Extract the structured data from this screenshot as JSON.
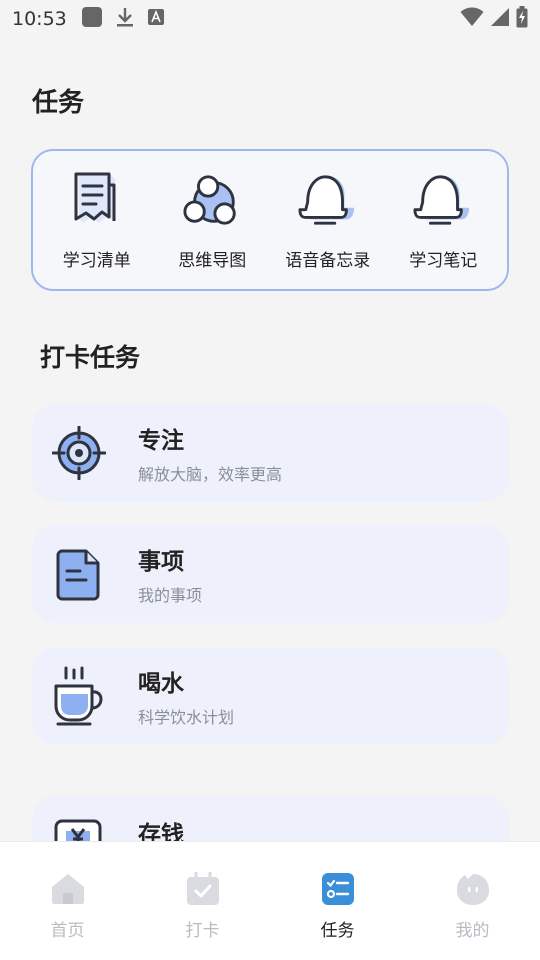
{
  "status_bar": {
    "time": "10:53",
    "left_icons": [
      "square-notification-icon",
      "download-icon",
      "keyboard-a-icon"
    ],
    "right_icons": [
      "wifi-icon",
      "cellular-signal-icon",
      "battery-charging-icon"
    ]
  },
  "page": {
    "title": "任务"
  },
  "tools": [
    {
      "label": "学习清单",
      "icon": "study-list-icon"
    },
    {
      "label": "思维导图",
      "icon": "mind-map-icon"
    },
    {
      "label": "语音备忘录",
      "icon": "voice-memo-icon"
    },
    {
      "label": "学习笔记",
      "icon": "study-notes-icon"
    }
  ],
  "checkin": {
    "title": "打卡任务",
    "tasks": [
      {
        "title": "专注",
        "subtitle": "解放大脑，效率更高",
        "icon": "target-icon"
      },
      {
        "title": "事项",
        "subtitle": "我的事项",
        "icon": "document-icon"
      },
      {
        "title": "喝水",
        "subtitle": "科学饮水计划",
        "icon": "cup-icon"
      },
      {
        "title": "存钱",
        "subtitle": "",
        "icon": "money-icon"
      }
    ]
  },
  "bottom_nav": {
    "items": [
      {
        "label": "首页",
        "icon": "home-icon",
        "active": false
      },
      {
        "label": "打卡",
        "icon": "checkin-icon",
        "active": false
      },
      {
        "label": "任务",
        "icon": "task-list-icon",
        "active": true
      },
      {
        "label": "我的",
        "icon": "profile-icon",
        "active": false
      }
    ]
  },
  "colors": {
    "accent": "#3b8fd8",
    "card_border": "#9fb8ec",
    "card_bg": "#eef1fb",
    "icon_fill": "#8fb0f0",
    "inactive_nav": "#b9bcc3"
  }
}
